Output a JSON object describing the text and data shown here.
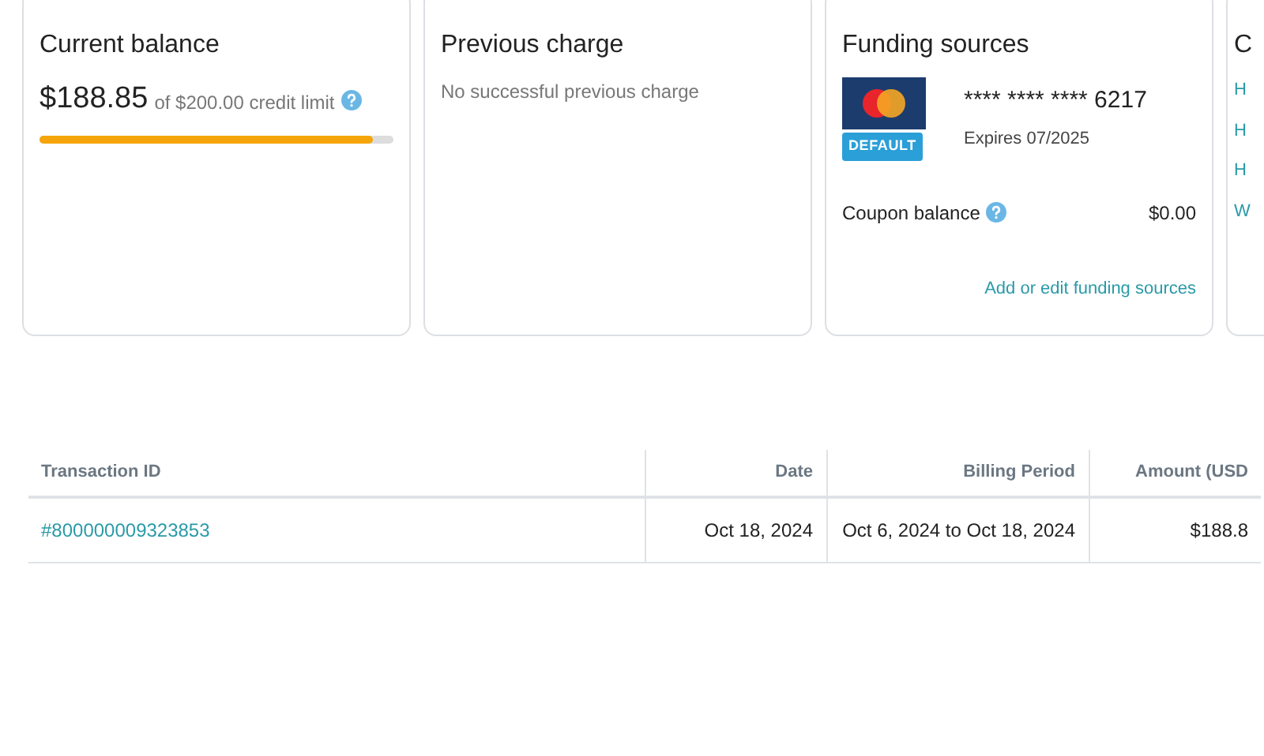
{
  "cards": [
    {
      "kind": "balance",
      "title": "Current balance",
      "amount": "$188.85",
      "limit_text": "of $200.00 credit limit",
      "level": 0.94
    },
    {
      "kind": "previous",
      "title": "Previous charge",
      "message": "No successful previous charge"
    },
    {
      "kind": "funding",
      "title": "Funding sources",
      "card_number": "**** **** **** 6217",
      "expires": "Expires 07/2025",
      "badge": "DEFAULT",
      "coupon_label": "Coupon balance",
      "coupon_value": "$0.00",
      "link": "Add or edit funding sources"
    },
    {
      "kind": "partial",
      "title": "C",
      "links": [
        "H",
        "H",
        "H",
        "W"
      ]
    }
  ],
  "table": {
    "columns": [
      "Transaction ID",
      "Date",
      "Billing Period",
      "Amount (USD"
    ],
    "rows": [
      [
        "#800000009323853",
        "Oct 18, 2024",
        "Oct 6, 2024 to Oct 18, 2024",
        "$188.8"
      ]
    ]
  }
}
